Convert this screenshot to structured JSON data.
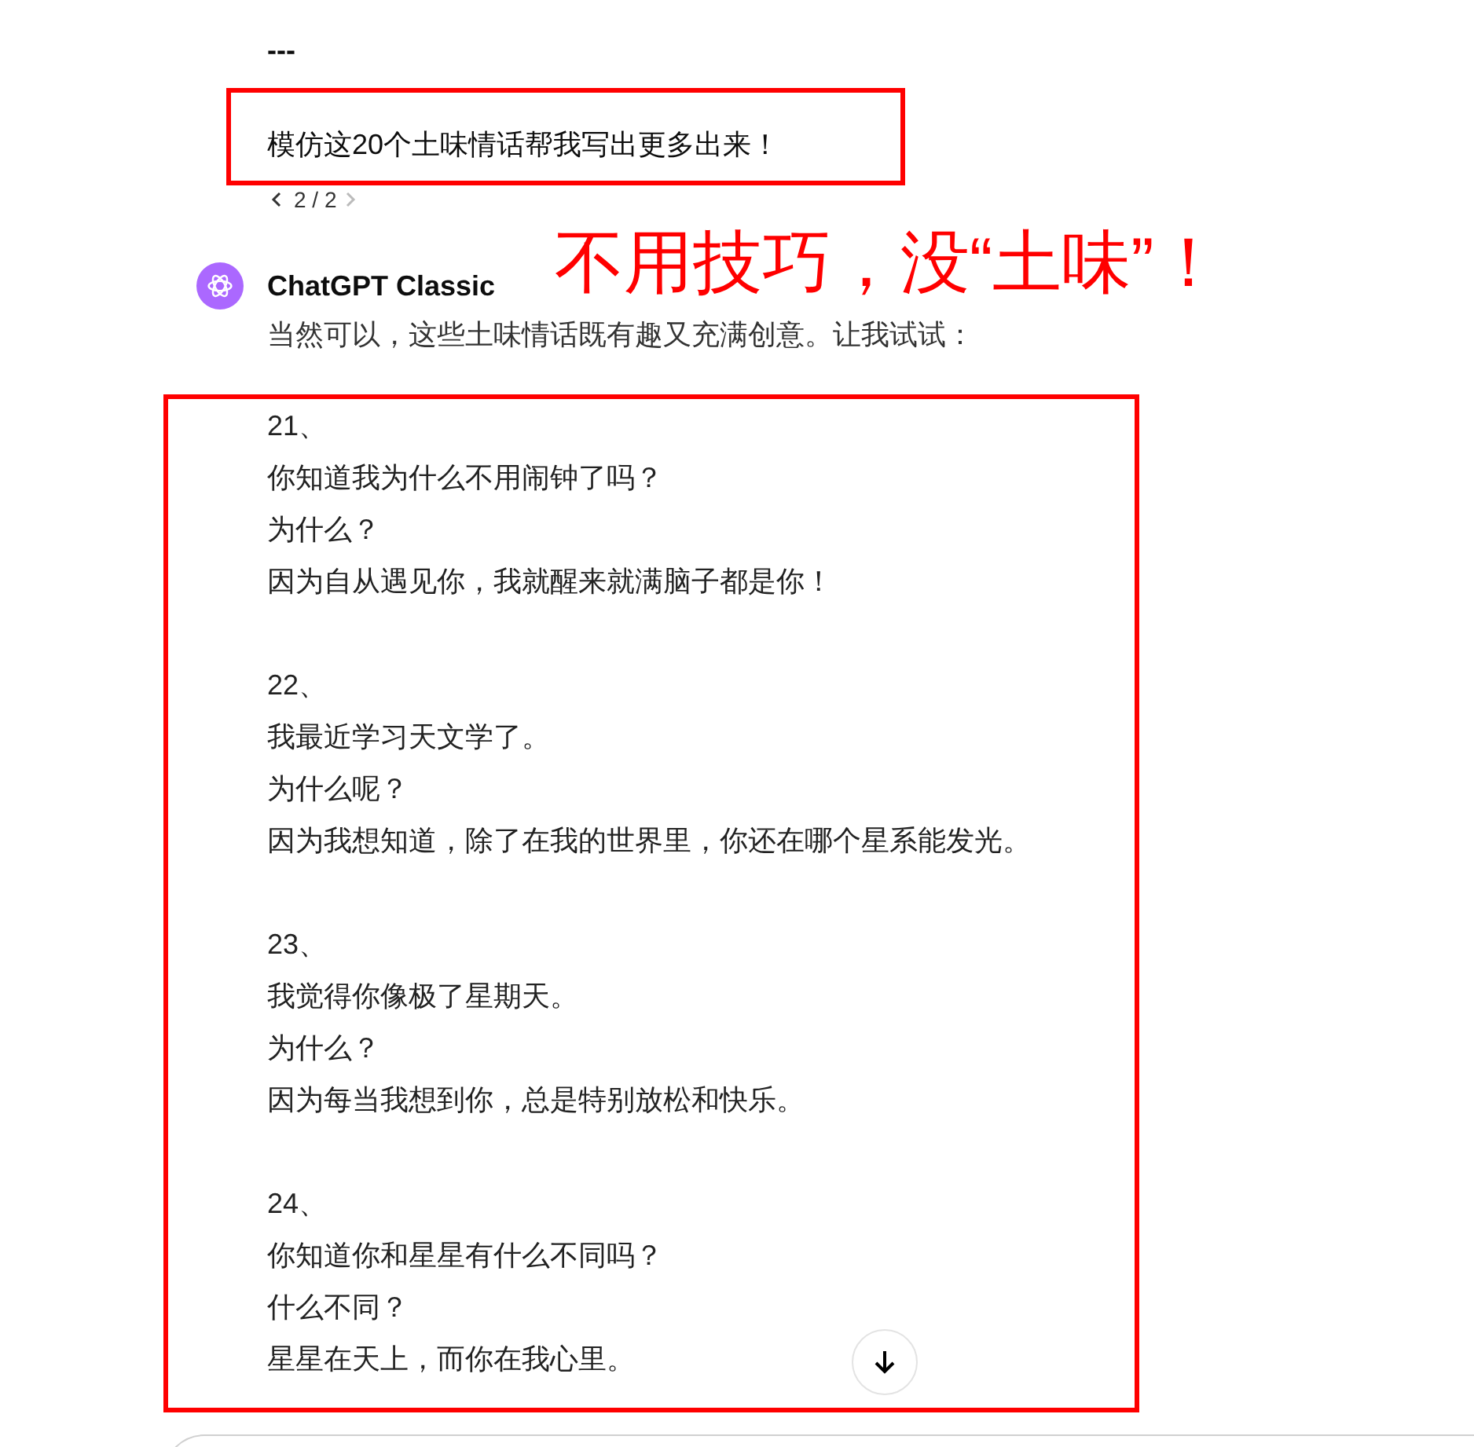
{
  "previous_text": "---",
  "user_message": {
    "text": "模仿这20个土味情话帮我写出更多出来！",
    "pager": "2 / 2"
  },
  "assistant": {
    "name": "ChatGPT Classic",
    "intro": "当然可以，这些土味情话既有趣又充满创意。让我试试：",
    "jokes": [
      {
        "number": "21、",
        "lines": [
          "你知道我为什么不用闹钟了吗？",
          "为什么？",
          "因为自从遇见你，我就醒来就满脑子都是你！"
        ]
      },
      {
        "number": "22、",
        "lines": [
          "我最近学习天文学了。",
          "为什么呢？",
          "因为我想知道，除了在我的世界里，你还在哪个星系能发光。"
        ]
      },
      {
        "number": "23、",
        "lines": [
          "我觉得你像极了星期天。",
          "为什么？",
          "因为每当我想到你，总是特别放松和快乐。"
        ]
      },
      {
        "number": "24、",
        "lines": [
          "你知道你和星星有什么不同吗？",
          "什么不同？",
          "星星在天上，而你在我心里。"
        ]
      }
    ]
  },
  "annotation": {
    "text": "不用技巧，没“土味”！"
  }
}
